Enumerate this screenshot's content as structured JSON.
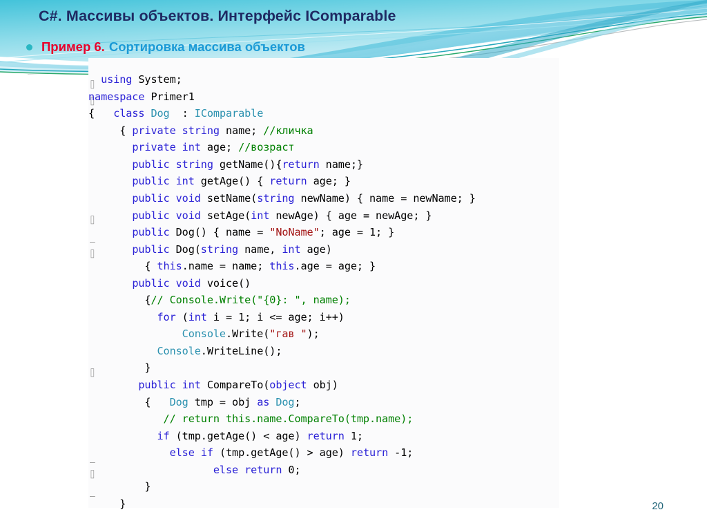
{
  "slide": {
    "title": "C#. Массивы объектов. Интерфейс IComparable",
    "bullet": {
      "icon": "bullet-dot",
      "label_red": "Пример 6.",
      "label_blue": "Сортировка массива объектов"
    },
    "page_number": "20"
  },
  "colors": {
    "title": "#1F2A63",
    "bullet_red": "#E8002A",
    "bullet_blue": "#1B9AD6",
    "bullet_dot": "#2AB7C3",
    "page_number": "#22667A",
    "banner_cyan": "#64CEE0",
    "banner_light": "#D7F1F7",
    "wave_teal": "#1BA3B8",
    "wave_green": "#13A05C",
    "wave_gray": "#A9AEB0",
    "code_background": "#FBFBFC",
    "syntax_keyword": "#2A21D6",
    "syntax_type": "#2B91AF",
    "syntax_string": "#A31515",
    "syntax_comment": "#008000",
    "syntax_plain": "#000000"
  },
  "code": {
    "language": "C#",
    "fold_markers": [
      "⌷",
      "⌷",
      "⌷",
      "⌷",
      "⌷",
      "⌷"
    ],
    "lines": [
      [
        {
          "t": "  ",
          "c": "pln"
        },
        {
          "t": "using",
          "c": "kw"
        },
        {
          "t": " System;",
          "c": "pln"
        }
      ],
      [
        {
          "t": "namespace",
          "c": "kw"
        },
        {
          "t": " Primer1",
          "c": "pln"
        }
      ],
      [
        {
          "t": "{   ",
          "c": "pln"
        },
        {
          "t": "class",
          "c": "kw"
        },
        {
          "t": " ",
          "c": "pln"
        },
        {
          "t": "Dog",
          "c": "typ"
        },
        {
          "t": "  : ",
          "c": "pln"
        },
        {
          "t": "IComparable",
          "c": "typ"
        }
      ],
      [
        {
          "t": "     { ",
          "c": "pln"
        },
        {
          "t": "private",
          "c": "kw"
        },
        {
          "t": " ",
          "c": "pln"
        },
        {
          "t": "string",
          "c": "kw"
        },
        {
          "t": " name; ",
          "c": "pln"
        },
        {
          "t": "//кличка",
          "c": "cmt"
        }
      ],
      [
        {
          "t": "       ",
          "c": "pln"
        },
        {
          "t": "private",
          "c": "kw"
        },
        {
          "t": " ",
          "c": "pln"
        },
        {
          "t": "int",
          "c": "kw"
        },
        {
          "t": " age; ",
          "c": "pln"
        },
        {
          "t": "//возраст",
          "c": "cmt"
        }
      ],
      [
        {
          "t": "       ",
          "c": "pln"
        },
        {
          "t": "public",
          "c": "kw"
        },
        {
          "t": " ",
          "c": "pln"
        },
        {
          "t": "string",
          "c": "kw"
        },
        {
          "t": " getName(){",
          "c": "pln"
        },
        {
          "t": "return",
          "c": "kw"
        },
        {
          "t": " name;}",
          "c": "pln"
        }
      ],
      [
        {
          "t": "       ",
          "c": "pln"
        },
        {
          "t": "public",
          "c": "kw"
        },
        {
          "t": " ",
          "c": "pln"
        },
        {
          "t": "int",
          "c": "kw"
        },
        {
          "t": " getAge() { ",
          "c": "pln"
        },
        {
          "t": "return",
          "c": "kw"
        },
        {
          "t": " age; }",
          "c": "pln"
        }
      ],
      [
        {
          "t": "       ",
          "c": "pln"
        },
        {
          "t": "public",
          "c": "kw"
        },
        {
          "t": " ",
          "c": "pln"
        },
        {
          "t": "void",
          "c": "kw"
        },
        {
          "t": " setName(",
          "c": "pln"
        },
        {
          "t": "string",
          "c": "kw"
        },
        {
          "t": " newName) { name = newName; }",
          "c": "pln"
        }
      ],
      [
        {
          "t": "       ",
          "c": "pln"
        },
        {
          "t": "public",
          "c": "kw"
        },
        {
          "t": " ",
          "c": "pln"
        },
        {
          "t": "void",
          "c": "kw"
        },
        {
          "t": " setAge(",
          "c": "pln"
        },
        {
          "t": "int",
          "c": "kw"
        },
        {
          "t": " newAge) { age = newAge; }",
          "c": "pln"
        }
      ],
      [
        {
          "t": "       ",
          "c": "pln"
        },
        {
          "t": "public",
          "c": "kw"
        },
        {
          "t": " Dog() { name = ",
          "c": "pln"
        },
        {
          "t": "\"NoName\"",
          "c": "str"
        },
        {
          "t": "; age = 1; }",
          "c": "pln"
        }
      ],
      [
        {
          "t": "       ",
          "c": "pln"
        },
        {
          "t": "public",
          "c": "kw"
        },
        {
          "t": " Dog(",
          "c": "pln"
        },
        {
          "t": "string",
          "c": "kw"
        },
        {
          "t": " name, ",
          "c": "pln"
        },
        {
          "t": "int",
          "c": "kw"
        },
        {
          "t": " age)",
          "c": "pln"
        }
      ],
      [
        {
          "t": "         { ",
          "c": "pln"
        },
        {
          "t": "this",
          "c": "kw"
        },
        {
          "t": ".name = name; ",
          "c": "pln"
        },
        {
          "t": "this",
          "c": "kw"
        },
        {
          "t": ".age = age; }",
          "c": "pln"
        }
      ],
      [
        {
          "t": "       ",
          "c": "pln"
        },
        {
          "t": "public",
          "c": "kw"
        },
        {
          "t": " ",
          "c": "pln"
        },
        {
          "t": "void",
          "c": "kw"
        },
        {
          "t": " voice()",
          "c": "pln"
        }
      ],
      [
        {
          "t": "         {",
          "c": "pln"
        },
        {
          "t": "// Console.Write(\"{0}: \", name);",
          "c": "cmt"
        }
      ],
      [
        {
          "t": "           ",
          "c": "pln"
        },
        {
          "t": "for",
          "c": "kw"
        },
        {
          "t": " (",
          "c": "pln"
        },
        {
          "t": "int",
          "c": "kw"
        },
        {
          "t": " i = 1; i <= age; i++)",
          "c": "pln"
        }
      ],
      [
        {
          "t": "               ",
          "c": "pln"
        },
        {
          "t": "Console",
          "c": "typ"
        },
        {
          "t": ".Write(",
          "c": "pln"
        },
        {
          "t": "\"гав \"",
          "c": "str"
        },
        {
          "t": ");",
          "c": "pln"
        }
      ],
      [
        {
          "t": "           ",
          "c": "pln"
        },
        {
          "t": "Console",
          "c": "typ"
        },
        {
          "t": ".WriteLine();",
          "c": "pln"
        }
      ],
      [
        {
          "t": "         }",
          "c": "pln"
        }
      ],
      [
        {
          "t": "        ",
          "c": "pln"
        },
        {
          "t": "public",
          "c": "kw"
        },
        {
          "t": " ",
          "c": "pln"
        },
        {
          "t": "int",
          "c": "kw"
        },
        {
          "t": " CompareTo(",
          "c": "pln"
        },
        {
          "t": "object",
          "c": "kw"
        },
        {
          "t": " obj)",
          "c": "pln"
        }
      ],
      [
        {
          "t": "         {   ",
          "c": "pln"
        },
        {
          "t": "Dog",
          "c": "typ"
        },
        {
          "t": " tmp = obj ",
          "c": "pln"
        },
        {
          "t": "as",
          "c": "kw"
        },
        {
          "t": " ",
          "c": "pln"
        },
        {
          "t": "Dog",
          "c": "typ"
        },
        {
          "t": ";",
          "c": "pln"
        }
      ],
      [
        {
          "t": "            ",
          "c": "pln"
        },
        {
          "t": "// return this.name.CompareTo(tmp.name);",
          "c": "cmt"
        }
      ],
      [
        {
          "t": "           ",
          "c": "pln"
        },
        {
          "t": "if",
          "c": "kw"
        },
        {
          "t": " (tmp.getAge() < age) ",
          "c": "pln"
        },
        {
          "t": "return",
          "c": "kw"
        },
        {
          "t": " 1;",
          "c": "pln"
        }
      ],
      [
        {
          "t": "             ",
          "c": "pln"
        },
        {
          "t": "else",
          "c": "kw"
        },
        {
          "t": " ",
          "c": "pln"
        },
        {
          "t": "if",
          "c": "kw"
        },
        {
          "t": " (tmp.getAge() > age) ",
          "c": "pln"
        },
        {
          "t": "return",
          "c": "kw"
        },
        {
          "t": " -1;",
          "c": "pln"
        }
      ],
      [
        {
          "t": "                    ",
          "c": "pln"
        },
        {
          "t": "else",
          "c": "kw"
        },
        {
          "t": " ",
          "c": "pln"
        },
        {
          "t": "return",
          "c": "kw"
        },
        {
          "t": " 0;",
          "c": "pln"
        }
      ],
      [
        {
          "t": "         }",
          "c": "pln"
        }
      ],
      [
        {
          "t": "     }",
          "c": "pln"
        }
      ]
    ]
  }
}
